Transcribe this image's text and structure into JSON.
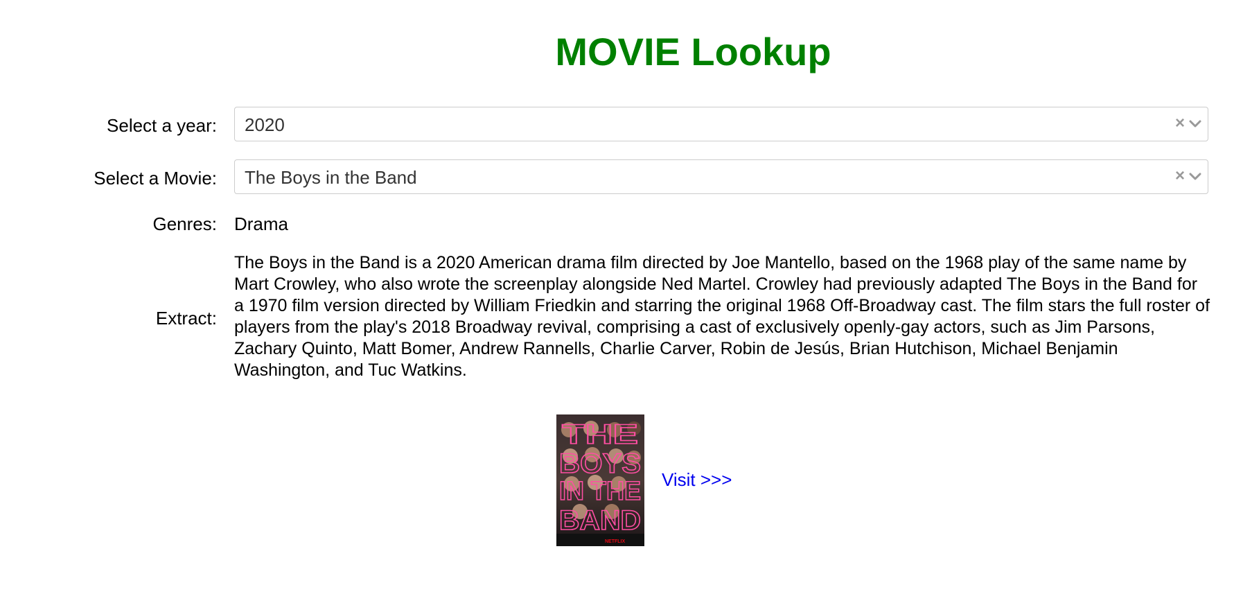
{
  "page": {
    "title": "MOVIE Lookup"
  },
  "form": {
    "year": {
      "label": "Select a year:",
      "value": "2020"
    },
    "movie": {
      "label": "Select a Movie:",
      "value": "The Boys in the Band"
    }
  },
  "details": {
    "genres_label": "Genres:",
    "genres_value": "Drama",
    "extract_label": "Extract:",
    "extract_text": "The Boys in the Band is a 2020 American drama film directed by Joe Mantello, based on the 1968 play of the same name by Mart Crowley, who also wrote the screenplay alongside Ned Martel. Crowley had previously adapted The Boys in the Band for a 1970 film version directed by William Friedkin and starring the original 1968 Off-Broadway cast. The film stars the full roster of players from the play's 2018 Broadway revival, comprising a cast of exclusively openly-gay actors, such as Jim Parsons, Zachary Quinto, Matt Bomer, Andrew Rannells, Charlie Carver, Robin de Jesús, Brian Hutchison, Michael Benjamin Washington, and Tuc Watkins."
  },
  "poster": {
    "title_lines": [
      "THE",
      "BOYS",
      "IN THE",
      "BAND"
    ],
    "brand": "NETFLIX"
  },
  "link": {
    "visit_label": "Visit >>>"
  },
  "icons": {
    "clear": "clear-icon",
    "dropdown": "chevron-down-icon"
  },
  "colors": {
    "title": "#008000",
    "link": "#0000ee",
    "poster_text": "#ff4fa3"
  }
}
